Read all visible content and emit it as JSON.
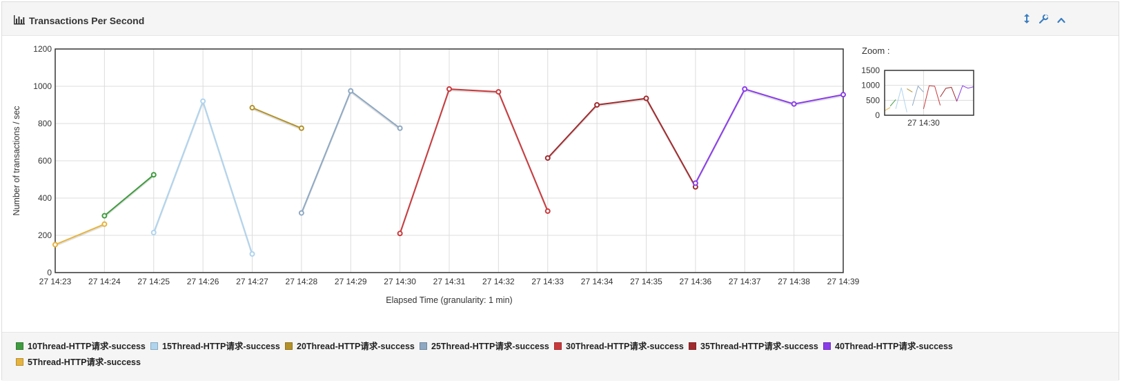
{
  "panel": {
    "title": "Transactions Per Second",
    "toolbar": [
      {
        "name": "resize-icon",
        "glyph": "↕"
      },
      {
        "name": "wrench-icon",
        "glyph": "🔧"
      },
      {
        "name": "collapse-icon",
        "glyph": "⌃"
      }
    ]
  },
  "zoom": {
    "label": "Zoom :",
    "yticks": [
      "1500",
      "1000",
      "500",
      "0"
    ],
    "xtick": "27 14:30"
  },
  "chart_data": {
    "type": "line",
    "title": "Transactions Per Second",
    "xlabel": "Elapsed Time (granularity: 1 min)",
    "ylabel": "Number of transactions / sec",
    "ylim": [
      0,
      1200
    ],
    "yticks": [
      0,
      200,
      400,
      600,
      800,
      1000,
      1200
    ],
    "x": [
      "27 14:23",
      "27 14:24",
      "27 14:25",
      "27 14:26",
      "27 14:27",
      "27 14:28",
      "27 14:29",
      "27 14:30",
      "27 14:31",
      "27 14:32",
      "27 14:33",
      "27 14:34",
      "27 14:35",
      "27 14:36",
      "27 14:37",
      "27 14:38",
      "27 14:39"
    ],
    "grid": true,
    "legend_position": "bottom",
    "series": [
      {
        "name": "10Thread-HTTP请求-success",
        "color": "#3f9b3f",
        "points": [
          [
            "27 14:24",
            305
          ],
          [
            "27 14:25",
            525
          ]
        ]
      },
      {
        "name": "15Thread-HTTP请求-success",
        "color": "#afd4ee",
        "points": [
          [
            "27 14:25",
            215
          ],
          [
            "27 14:26",
            920
          ],
          [
            "27 14:27",
            100
          ]
        ]
      },
      {
        "name": "20Thread-HTTP请求-success",
        "color": "#b3912a",
        "points": [
          [
            "27 14:27",
            885
          ],
          [
            "27 14:28",
            775
          ]
        ]
      },
      {
        "name": "25Thread-HTTP请求-success",
        "color": "#8ea8c3",
        "points": [
          [
            "27 14:28",
            320
          ],
          [
            "27 14:29",
            975
          ],
          [
            "27 14:30",
            775
          ]
        ]
      },
      {
        "name": "30Thread-HTTP请求-success",
        "color": "#c9393c",
        "points": [
          [
            "27 14:30",
            210
          ],
          [
            "27 14:31",
            985
          ],
          [
            "27 14:32",
            970
          ],
          [
            "27 14:33",
            330
          ]
        ]
      },
      {
        "name": "35Thread-HTTP请求-success",
        "color": "#a02a2d",
        "points": [
          [
            "27 14:33",
            615
          ],
          [
            "27 14:34",
            900
          ],
          [
            "27 14:35",
            935
          ],
          [
            "27 14:36",
            460
          ]
        ]
      },
      {
        "name": "40Thread-HTTP请求-success",
        "color": "#8a3cea",
        "points": [
          [
            "27 14:36",
            480
          ],
          [
            "27 14:37",
            985
          ],
          [
            "27 14:38",
            905
          ],
          [
            "27 14:39",
            955
          ]
        ]
      },
      {
        "name": "5Thread-HTTP请求-success",
        "color": "#e6b33d",
        "points": [
          [
            "27 14:23",
            150
          ],
          [
            "27 14:24",
            260
          ]
        ]
      }
    ]
  }
}
